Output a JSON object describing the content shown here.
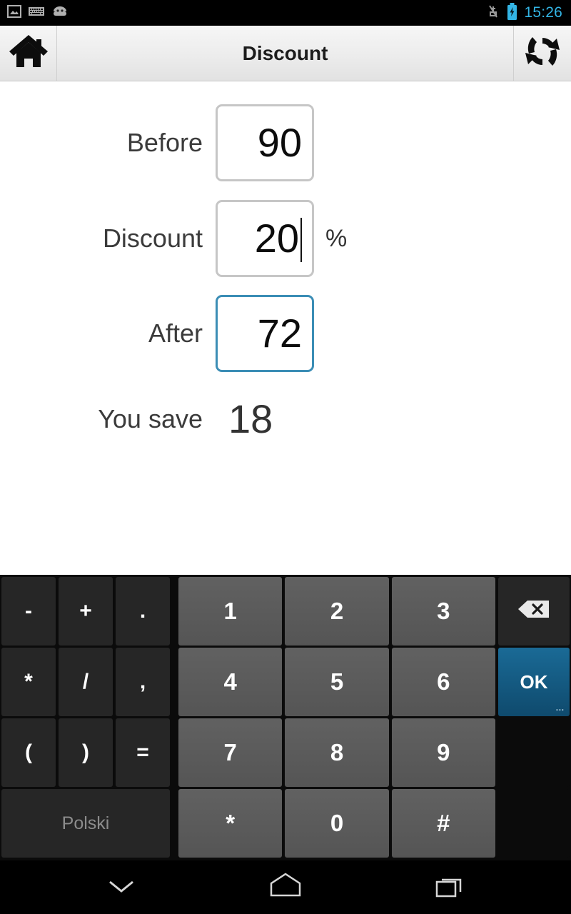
{
  "statusbar": {
    "time": "15:26",
    "left_icons": [
      "gallery-icon",
      "keyboard-icon",
      "android-icon"
    ],
    "right_icons": [
      "vibrate-off-icon",
      "battery-charging-icon"
    ],
    "accent_color": "#33b5e5"
  },
  "actionbar": {
    "home_icon": "home-icon",
    "title": "Discount",
    "refresh_icon": "refresh-icon"
  },
  "form": {
    "rows": [
      {
        "label": "Before",
        "value": "90",
        "suffix": "",
        "focused": false,
        "boxed": true
      },
      {
        "label": "Discount",
        "value": "20",
        "suffix": "%",
        "focused": false,
        "boxed": true,
        "caret": true
      },
      {
        "label": "After",
        "value": "72",
        "suffix": "",
        "focused": true,
        "boxed": true
      },
      {
        "label": "You save",
        "value": "18",
        "suffix": "",
        "focused": false,
        "boxed": false
      }
    ],
    "focus_border_color": "#3b8db5",
    "idle_border_color": "#c6c6c6"
  },
  "keyboard": {
    "rows": [
      {
        "fn": [
          "-",
          "+",
          "."
        ],
        "num": [
          "1",
          "2",
          "3"
        ],
        "side": "backspace-icon",
        "side_type": "backspace"
      },
      {
        "fn": [
          "*",
          "/",
          ","
        ],
        "num": [
          "4",
          "5",
          "6"
        ],
        "side": "OK",
        "side_type": "ok"
      },
      {
        "fn": [
          "(",
          ")",
          "="
        ],
        "num": [
          "7",
          "8",
          "9"
        ],
        "side": "",
        "side_type": "empty"
      },
      {
        "space": "Polski",
        "num": [
          "*",
          "0",
          "#"
        ],
        "side": "",
        "side_type": "empty"
      }
    ],
    "ok_color": "#14597f",
    "num_key_color": "#5c5c5c",
    "fn_key_color": "#262626",
    "ok_dots": "..."
  },
  "navbar": {
    "buttons": [
      "hide-keyboard-icon",
      "home-icon",
      "recents-icon"
    ]
  }
}
